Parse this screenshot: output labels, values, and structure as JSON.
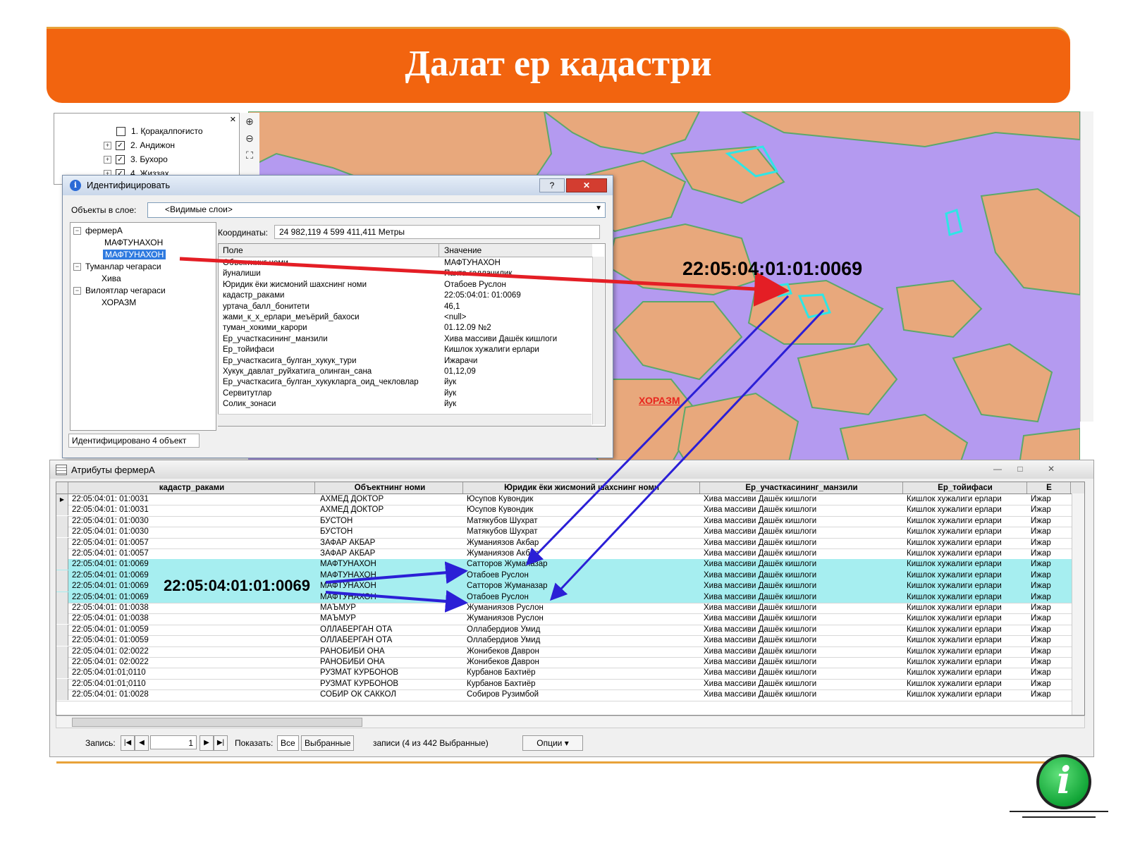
{
  "slide": {
    "title": "Далат ер кадастри"
  },
  "layer_tree": {
    "items": [
      {
        "label": "1. Қорақалпоғисто",
        "checked": false,
        "check_mark": ""
      },
      {
        "label": "2. Андижон",
        "checked": true,
        "check_mark": "✓"
      },
      {
        "label": "3. Бухоро",
        "checked": true,
        "check_mark": "✓"
      },
      {
        "label": "4. Жиззах",
        "checked": true,
        "check_mark": "✓"
      }
    ]
  },
  "map": {
    "region_label": "ХОРАЗМ",
    "parcel_callout": "22:05:04:01:01:0069",
    "colors": {
      "water": "#b49af0",
      "land": "#e8a87c",
      "roads": "#5ca86a",
      "highlight": "#2ee6e6"
    }
  },
  "identify_dialog": {
    "title": "Идентифицировать",
    "help_label": "?",
    "close_label": "✕",
    "layer_label": "Объекты в слое:",
    "layer_value": "<Видимые слои>",
    "tree": [
      {
        "label": "фермерА",
        "level": 0,
        "selected": false
      },
      {
        "label": "МАФТУНАХОН",
        "level": 1,
        "selected": false
      },
      {
        "label": "МАФТУНАХОН",
        "level": 1,
        "selected": true
      },
      {
        "label": "Туманлар чегараси",
        "level": 0,
        "selected": false
      },
      {
        "label": "Хива",
        "level": 1,
        "selected": false
      },
      {
        "label": "Вилоятлар чегараси",
        "level": 0,
        "selected": false
      },
      {
        "label": "ХОРАЗМ",
        "level": 1,
        "selected": false
      }
    ],
    "coords_label": "Координаты:",
    "coords_value": "24 982,119  4 599 411,411 Метры",
    "columns": {
      "field": "Поле",
      "value": "Значение"
    },
    "rows": [
      {
        "field": "Объектнинг номи",
        "value": "МАФТУНАХОН"
      },
      {
        "field": "йуналиши",
        "value": "Пахта-ғаллачилик"
      },
      {
        "field": "Юридик ёки жисмоний шахснинг номи",
        "value": "Отабоев Руслон"
      },
      {
        "field": "кадастр_раками",
        "value": "22:05:04:01: 01:0069"
      },
      {
        "field": "уртача_балл_бонитети",
        "value": "46,1"
      },
      {
        "field": "жами_к_х_ерлари_меъёрий_бахоси",
        "value": "<null>"
      },
      {
        "field": "туман_хокими_карори",
        "value": "01.12.09 №2"
      },
      {
        "field": "Ер_участкасининг_манзили",
        "value": "Хива массиви Дашёк кишлоги"
      },
      {
        "field": "Ер_тойифаси",
        "value": "Кишлок хужалиги ерлари"
      },
      {
        "field": "Ер_участкасига_булган_хукук_тури",
        "value": "Ижарачи"
      },
      {
        "field": "Хукук_давлат_руйхатига_олинган_сана",
        "value": "01,12,09"
      },
      {
        "field": "Ер_участкасига_булган_хукукларга_оид_чекловлар",
        "value": "йук"
      },
      {
        "field": "Сервитутлар",
        "value": "йук"
      },
      {
        "field": "Солик_зонаси",
        "value": "йук"
      }
    ],
    "status": "Идентифицировано 4 объект"
  },
  "attribute_table": {
    "title": "Атрибуты фермерА",
    "minimize": "—",
    "maximize": "□",
    "close": "✕",
    "columns": [
      "кадастр_раками",
      "Объектнинг номи",
      "Юридик ёки жисмоний шахснинг номи",
      "Ер_участкасининг_манзили",
      "Ер_тойифаси",
      "Е"
    ],
    "rows": [
      {
        "cells": [
          "22:05:04:01: 01:0031",
          "АХМЕД ДОКТОР",
          "Юсупов Кувондик",
          "Хива массиви Дашёк кишлоги",
          "Кишлок хужалиги ерлари",
          "Ижар"
        ],
        "selected": false
      },
      {
        "cells": [
          "22:05:04:01: 01:0031",
          "АХМЕД ДОКТОР",
          "Юсупов Кувондик",
          "Хива массиви Дашёк кишлоги",
          "Кишлок хужалиги ерлари",
          "Ижар"
        ],
        "selected": false
      },
      {
        "cells": [
          "22:05:04:01: 01:0030",
          "БУСТОН",
          "Матякубов Шухрат",
          "Хива массиви Дашёк кишлоги",
          "Кишлок хужалиги ерлари",
          "Ижар"
        ],
        "selected": false
      },
      {
        "cells": [
          "22:05:04:01: 01:0030",
          "БУСТОН",
          "Матякубов Шухрат",
          "Хива массиви Дашёк кишлоги",
          "Кишлок хужалиги ерлари",
          "Ижар"
        ],
        "selected": false
      },
      {
        "cells": [
          "22:05:04:01: 01:0057",
          "ЗАФАР АКБАР",
          "Жуманиязов Акбар",
          "Хива массиви Дашёк кишлоги",
          "Кишлок хужалиги ерлари",
          "Ижар"
        ],
        "selected": false
      },
      {
        "cells": [
          "22:05:04:01: 01:0057",
          "ЗАФАР АКБАР",
          "Жуманиязов Акбар",
          "Хива массиви Дашёк кишлоги",
          "Кишлок хужалиги ерлари",
          "Ижар"
        ],
        "selected": false
      },
      {
        "cells": [
          "22:05:04:01: 01:0069",
          "МАФТУНАХОН",
          "Сатторов Жуманазар",
          "Хива массиви Дашёк кишлоги",
          "Кишлок хужалиги ерлари",
          "Ижар"
        ],
        "selected": true
      },
      {
        "cells": [
          "22:05:04:01: 01:0069",
          "МАФТУНАХОН",
          "Отабоев Руслон",
          "Хива массиви Дашёк кишлоги",
          "Кишлок хужалиги ерлари",
          "Ижар"
        ],
        "selected": true
      },
      {
        "cells": [
          "22:05:04:01: 01:0069",
          "МАФТУНАХОН",
          "Сатторов Жуманазар",
          "Хива массиви Дашёк кишлоги",
          "Кишлок хужалиги ерлари",
          "Ижар"
        ],
        "selected": true
      },
      {
        "cells": [
          "22:05:04:01: 01:0069",
          "МАФТУНАХОН",
          "Отабоев Руслон",
          "Хива массиви Дашёк кишлоги",
          "Кишлок хужалиги ерлари",
          "Ижар"
        ],
        "selected": true
      },
      {
        "cells": [
          "22:05:04:01: 01:0038",
          "МАЪМУР",
          "Жуманиязов Руслон",
          "Хива массиви Дашёк кишлоги",
          "Кишлок хужалиги ерлари",
          "Ижар"
        ],
        "selected": false
      },
      {
        "cells": [
          "22:05:04:01: 01:0038",
          "МАЪМУР",
          "Жуманиязов Руслон",
          "Хива массиви Дашёк кишлоги",
          "Кишлок хужалиги ерлари",
          "Ижар"
        ],
        "selected": false
      },
      {
        "cells": [
          "22:05:04:01: 01:0059",
          "ОЛЛАБЕРГАН ОТА",
          "Оллабердиов Умид",
          "Хива массиви Дашёк кишлоги",
          "Кишлок хужалиги ерлари",
          "Ижар"
        ],
        "selected": false
      },
      {
        "cells": [
          "22:05:04:01: 01:0059",
          "ОЛЛАБЕРГАН ОТА",
          "Оллабердиов Умид",
          "Хива массиви Дашёк кишлоги",
          "Кишлок хужалиги ерлари",
          "Ижар"
        ],
        "selected": false
      },
      {
        "cells": [
          "22:05:04:01: 02:0022",
          "РАНОБИБИ ОНА",
          "Жонибеков Даврон",
          "Хива массиви Дашёк кишлоги",
          "Кишлок хужалиги ерлари",
          "Ижар"
        ],
        "selected": false
      },
      {
        "cells": [
          "22:05:04:01: 02:0022",
          "РАНОБИБИ ОНА",
          "Жонибеков Даврон",
          "Хива массиви Дашёк кишлоги",
          "Кишлок хужалиги ерлари",
          "Ижар"
        ],
        "selected": false
      },
      {
        "cells": [
          "22:05:04:01:01;0110",
          "РУЗМАТ КУРБОНОВ",
          "Курбанов Бахтиёр",
          "Хива массиви Дашёк кишлоги",
          "Кишлок хужалиги ерлари",
          "Ижар"
        ],
        "selected": false
      },
      {
        "cells": [
          "22:05:04:01:01;0110",
          "РУЗМАТ КУРБОНОВ",
          "Курбанов Бахтиёр",
          "Хива массиви Дашёк кишлоги",
          "Кишлок хужалиги ерлари",
          "Ижар"
        ],
        "selected": false
      },
      {
        "cells": [
          "22:05:04:01: 01:0028",
          "СОБИР ОК САККОЛ",
          "Собиров Рузимбой",
          "Хива массиви Дашёк кишлоги",
          "Кишлок хужалиги ерлари",
          "Ижар"
        ],
        "selected": false
      }
    ],
    "callout": "22:05:04:01:01:0069",
    "nav": {
      "record_label": "Запись:",
      "record_value": "1",
      "show_label": "Показать:",
      "all_label": "Все",
      "selected_label": "Выбранные",
      "records_text": "записи (4 из 442 Выбранные)",
      "options_label": "Опции"
    }
  },
  "logo": {
    "glyph": "i"
  }
}
